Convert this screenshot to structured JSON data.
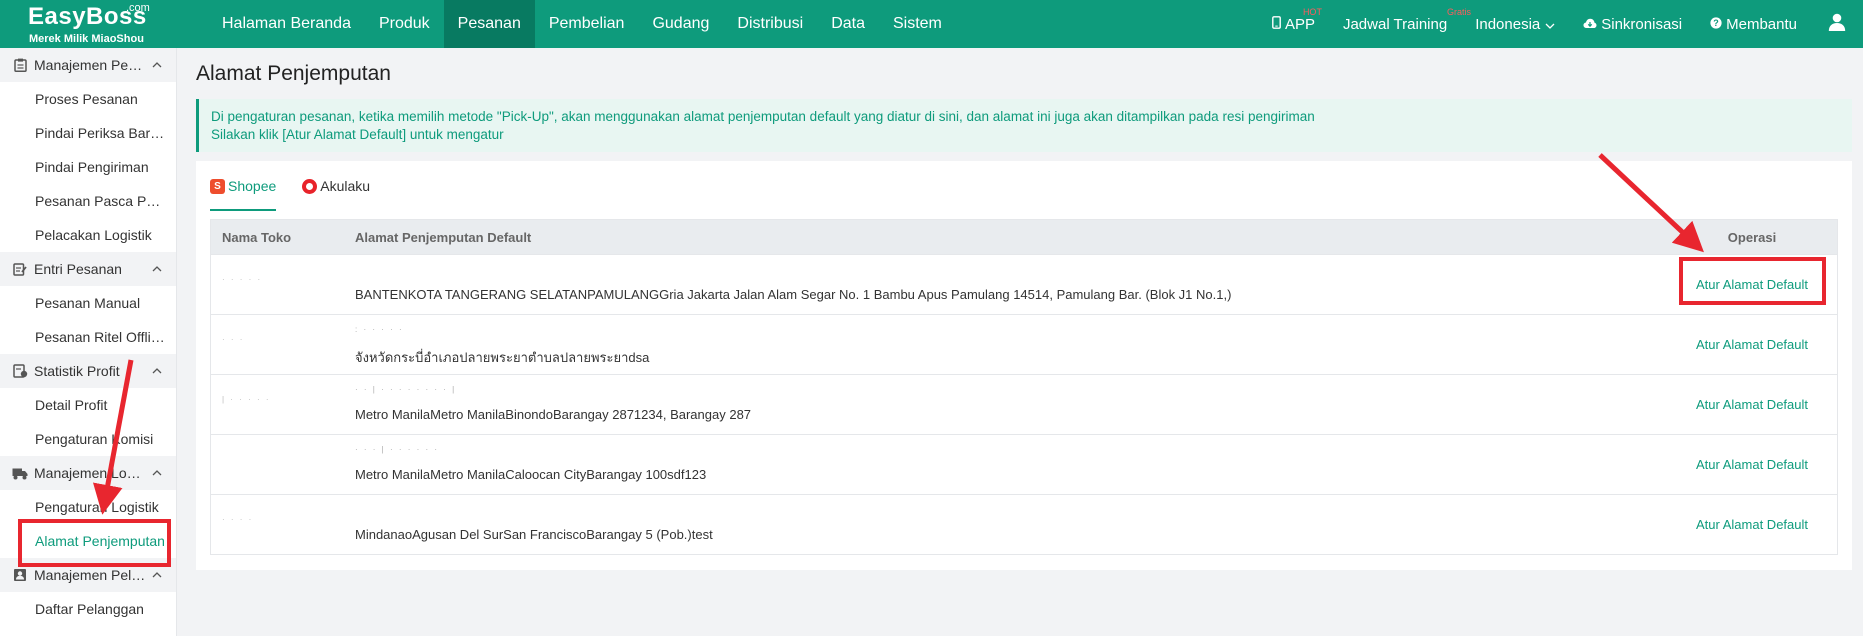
{
  "brand": {
    "name": "EasyBoss",
    "suffix": ".com",
    "tagline": "Merek Milik MiaoShou"
  },
  "main_nav": [
    {
      "label": "Halaman Beranda",
      "active": false
    },
    {
      "label": "Produk",
      "active": false
    },
    {
      "label": "Pesanan",
      "active": true
    },
    {
      "label": "Pembelian",
      "active": false
    },
    {
      "label": "Gudang",
      "active": false
    },
    {
      "label": "Distribusi",
      "active": false
    },
    {
      "label": "Data",
      "active": false
    },
    {
      "label": "Sistem",
      "active": false
    }
  ],
  "right_nav": {
    "app_label": "APP",
    "app_badge": "HOT",
    "training_label": "Jadwal Training",
    "training_badge": "Gratis",
    "language": "Indonesia",
    "sync_label": "Sinkronisasi",
    "help_label": "Membantu"
  },
  "sidebar": {
    "groups": [
      {
        "label": "Manajemen Pesanan",
        "icon": "clipboard-icon",
        "items": [
          "Proses Pesanan",
          "Pindai Periksa Barang",
          "Pindai Pengiriman",
          "Pesanan Pasca Penjualan",
          "Pelacakan Logistik"
        ]
      },
      {
        "label": "Entri Pesanan",
        "icon": "edit-icon",
        "items": [
          "Pesanan Manual",
          "Pesanan Ritel Offline"
        ]
      },
      {
        "label": "Statistik Profit",
        "icon": "chart-icon",
        "items": [
          "Detail Profit",
          "Pengaturan Komisi"
        ]
      },
      {
        "label": "Manajemen Logistik",
        "icon": "truck-icon",
        "items": [
          "Pengaturan Logistik",
          "Alamat Penjemputan"
        ]
      },
      {
        "label": "Manajemen Pelanggan",
        "icon": "contact-icon",
        "items": [
          "Daftar Pelanggan"
        ]
      }
    ],
    "active_item": "Alamat Penjemputan"
  },
  "page": {
    "title": "Alamat Penjemputan",
    "notice_line1": "Di pengaturan pesanan, ketika memilih metode \"Pick-Up\", akan menggunakan alamat penjemputan default yang diatur di sini, dan alamat ini juga akan ditampilkan pada resi pengiriman",
    "notice_line2": "Silakan klik [Atur Alamat Default] untuk mengatur"
  },
  "tabs": [
    {
      "label": "Shopee",
      "active": true,
      "icon": "shopee-icon"
    },
    {
      "label": "Akulaku",
      "active": false,
      "icon": "akulaku-icon"
    }
  ],
  "table": {
    "columns": [
      "Nama Toko",
      "Alamat Penjemputan Default",
      "Operasi"
    ],
    "rows": [
      {
        "store": "· · · ·  ·",
        "masked": "",
        "address": "BANTENKOTA TANGERANG SELATANPAMULANGGria Jakarta Jalan Alam Segar No. 1 Bambu Apus Pamulang 14514, Pamulang Bar. (Blok J1 No.1,)",
        "action": "Atur Alamat Default"
      },
      {
        "store": "· · ·",
        "masked": ": · · · · ·",
        "address": "จังหวัดกระบี่อำเภอปลายพระยาตำบลปลายพระยาdsa",
        "action": "Atur Alamat Default"
      },
      {
        "store": "| · · · · ·",
        "masked": "· · | · · · · · · · · |",
        "address": "Metro ManilaMetro ManilaBinondoBarangay 2871234, Barangay 287",
        "action": "Atur Alamat Default"
      },
      {
        "store": "",
        "masked": "· · · | · · · · · ·",
        "address": "Metro ManilaMetro ManilaCaloocan CityBarangay 100sdf123",
        "action": "Atur Alamat Default"
      },
      {
        "store": "· · ·  ·",
        "masked": "",
        "address": "MindanaoAgusan Del SurSan FranciscoBarangay 5 (Pob.)test",
        "action": "Atur Alamat Default"
      }
    ]
  },
  "colors": {
    "brand": "#0e9b7c",
    "brand_dark": "#087a61",
    "annotation": "#e8262f"
  }
}
